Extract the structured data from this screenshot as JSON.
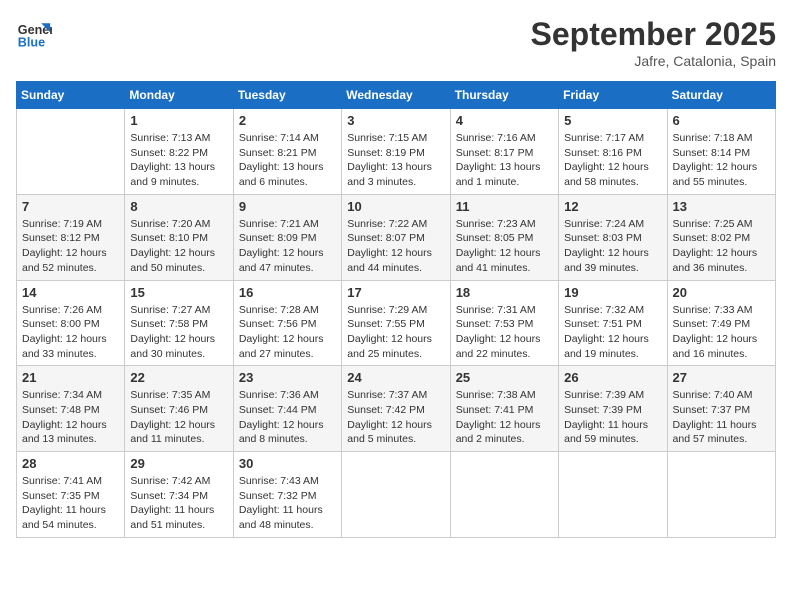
{
  "header": {
    "logo_line1": "General",
    "logo_line2": "Blue",
    "month": "September 2025",
    "location": "Jafre, Catalonia, Spain"
  },
  "weekdays": [
    "Sunday",
    "Monday",
    "Tuesday",
    "Wednesday",
    "Thursday",
    "Friday",
    "Saturday"
  ],
  "weeks": [
    [
      {
        "day": "",
        "info": ""
      },
      {
        "day": "1",
        "info": "Sunrise: 7:13 AM\nSunset: 8:22 PM\nDaylight: 13 hours\nand 9 minutes."
      },
      {
        "day": "2",
        "info": "Sunrise: 7:14 AM\nSunset: 8:21 PM\nDaylight: 13 hours\nand 6 minutes."
      },
      {
        "day": "3",
        "info": "Sunrise: 7:15 AM\nSunset: 8:19 PM\nDaylight: 13 hours\nand 3 minutes."
      },
      {
        "day": "4",
        "info": "Sunrise: 7:16 AM\nSunset: 8:17 PM\nDaylight: 13 hours\nand 1 minute."
      },
      {
        "day": "5",
        "info": "Sunrise: 7:17 AM\nSunset: 8:16 PM\nDaylight: 12 hours\nand 58 minutes."
      },
      {
        "day": "6",
        "info": "Sunrise: 7:18 AM\nSunset: 8:14 PM\nDaylight: 12 hours\nand 55 minutes."
      }
    ],
    [
      {
        "day": "7",
        "info": "Sunrise: 7:19 AM\nSunset: 8:12 PM\nDaylight: 12 hours\nand 52 minutes."
      },
      {
        "day": "8",
        "info": "Sunrise: 7:20 AM\nSunset: 8:10 PM\nDaylight: 12 hours\nand 50 minutes."
      },
      {
        "day": "9",
        "info": "Sunrise: 7:21 AM\nSunset: 8:09 PM\nDaylight: 12 hours\nand 47 minutes."
      },
      {
        "day": "10",
        "info": "Sunrise: 7:22 AM\nSunset: 8:07 PM\nDaylight: 12 hours\nand 44 minutes."
      },
      {
        "day": "11",
        "info": "Sunrise: 7:23 AM\nSunset: 8:05 PM\nDaylight: 12 hours\nand 41 minutes."
      },
      {
        "day": "12",
        "info": "Sunrise: 7:24 AM\nSunset: 8:03 PM\nDaylight: 12 hours\nand 39 minutes."
      },
      {
        "day": "13",
        "info": "Sunrise: 7:25 AM\nSunset: 8:02 PM\nDaylight: 12 hours\nand 36 minutes."
      }
    ],
    [
      {
        "day": "14",
        "info": "Sunrise: 7:26 AM\nSunset: 8:00 PM\nDaylight: 12 hours\nand 33 minutes."
      },
      {
        "day": "15",
        "info": "Sunrise: 7:27 AM\nSunset: 7:58 PM\nDaylight: 12 hours\nand 30 minutes."
      },
      {
        "day": "16",
        "info": "Sunrise: 7:28 AM\nSunset: 7:56 PM\nDaylight: 12 hours\nand 27 minutes."
      },
      {
        "day": "17",
        "info": "Sunrise: 7:29 AM\nSunset: 7:55 PM\nDaylight: 12 hours\nand 25 minutes."
      },
      {
        "day": "18",
        "info": "Sunrise: 7:31 AM\nSunset: 7:53 PM\nDaylight: 12 hours\nand 22 minutes."
      },
      {
        "day": "19",
        "info": "Sunrise: 7:32 AM\nSunset: 7:51 PM\nDaylight: 12 hours\nand 19 minutes."
      },
      {
        "day": "20",
        "info": "Sunrise: 7:33 AM\nSunset: 7:49 PM\nDaylight: 12 hours\nand 16 minutes."
      }
    ],
    [
      {
        "day": "21",
        "info": "Sunrise: 7:34 AM\nSunset: 7:48 PM\nDaylight: 12 hours\nand 13 minutes."
      },
      {
        "day": "22",
        "info": "Sunrise: 7:35 AM\nSunset: 7:46 PM\nDaylight: 12 hours\nand 11 minutes."
      },
      {
        "day": "23",
        "info": "Sunrise: 7:36 AM\nSunset: 7:44 PM\nDaylight: 12 hours\nand 8 minutes."
      },
      {
        "day": "24",
        "info": "Sunrise: 7:37 AM\nSunset: 7:42 PM\nDaylight: 12 hours\nand 5 minutes."
      },
      {
        "day": "25",
        "info": "Sunrise: 7:38 AM\nSunset: 7:41 PM\nDaylight: 12 hours\nand 2 minutes."
      },
      {
        "day": "26",
        "info": "Sunrise: 7:39 AM\nSunset: 7:39 PM\nDaylight: 11 hours\nand 59 minutes."
      },
      {
        "day": "27",
        "info": "Sunrise: 7:40 AM\nSunset: 7:37 PM\nDaylight: 11 hours\nand 57 minutes."
      }
    ],
    [
      {
        "day": "28",
        "info": "Sunrise: 7:41 AM\nSunset: 7:35 PM\nDaylight: 11 hours\nand 54 minutes."
      },
      {
        "day": "29",
        "info": "Sunrise: 7:42 AM\nSunset: 7:34 PM\nDaylight: 11 hours\nand 51 minutes."
      },
      {
        "day": "30",
        "info": "Sunrise: 7:43 AM\nSunset: 7:32 PM\nDaylight: 11 hours\nand 48 minutes."
      },
      {
        "day": "",
        "info": ""
      },
      {
        "day": "",
        "info": ""
      },
      {
        "day": "",
        "info": ""
      },
      {
        "day": "",
        "info": ""
      }
    ]
  ]
}
